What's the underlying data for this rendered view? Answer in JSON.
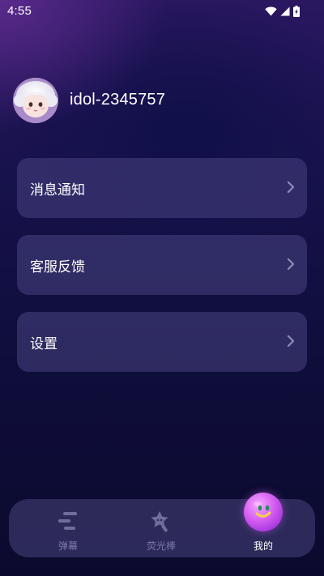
{
  "status_bar": {
    "time": "4:55",
    "icons": [
      "wifi-icon",
      "cellular-signal-icon",
      "battery-charging-icon"
    ]
  },
  "profile": {
    "username": "idol-2345757",
    "avatar": "avatar-image"
  },
  "menu": {
    "items": [
      {
        "label": "消息通知",
        "icon": "chevron-right-icon"
      },
      {
        "label": "客服反馈",
        "icon": "chevron-right-icon"
      },
      {
        "label": "设置",
        "icon": "chevron-right-icon"
      }
    ]
  },
  "bottom_nav": {
    "items": [
      {
        "label": "弹幕",
        "icon": "barrage-icon",
        "active": false
      },
      {
        "label": "荧光棒",
        "icon": "star-lightstick-icon",
        "active": false
      },
      {
        "label": "我的",
        "icon": "smiley-icon",
        "active": true
      }
    ]
  },
  "colors": {
    "accent": "#d45cf0",
    "inactive_nav": "#7c7aa6",
    "card_bg": "#48448c"
  }
}
